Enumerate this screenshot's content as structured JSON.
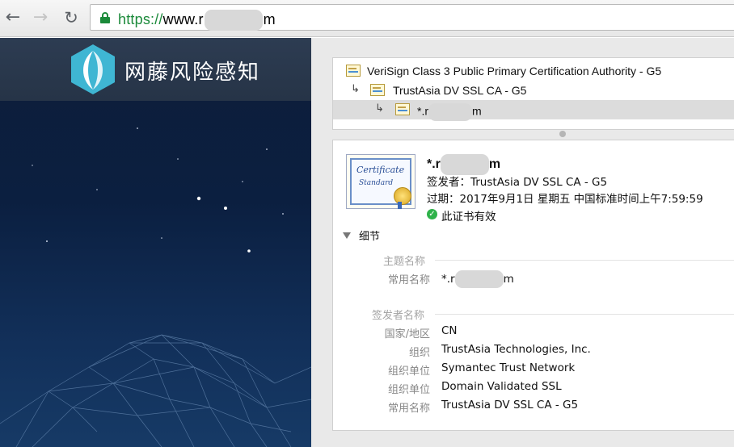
{
  "browser": {
    "url_scheme": "https://",
    "url_prefix": "www.r",
    "url_suffix": "m",
    "icons": {
      "back": "back-arrow-icon",
      "forward": "forward-arrow-icon",
      "reload": "reload-icon",
      "lock": "lock-icon"
    },
    "colors": {
      "secure_green": "#1b8a3a"
    }
  },
  "site": {
    "brand_name": "网藤风险感知",
    "colors": {
      "logo_teal": "#3fb6d3",
      "header_bg": "#2d3c52",
      "page_bg": "#0b1f40"
    }
  },
  "cert_chain": [
    {
      "label": "VeriSign Class 3 Public Primary Certification Authority - G5",
      "level": 0,
      "masked": false
    },
    {
      "label": "TrustAsia DV SSL CA - G5",
      "level": 1,
      "masked": false
    },
    {
      "label_prefix": "*.r",
      "label_suffix": "m",
      "level": 2,
      "masked": true,
      "selected": true
    }
  ],
  "cert": {
    "name_prefix": "*.r",
    "name_suffix": "m",
    "image_text_1": "Certificate",
    "image_text_2": "Standard",
    "issuer_line": "签发者：TrustAsia DV SSL CA - G5",
    "expiry_line": "过期：2017年9月1日 星期五 中国标准时间上午7:59:59",
    "valid_text": "此证书有效",
    "valid_color": "#2fb24a"
  },
  "details": {
    "toggle_label": "细节",
    "subject": {
      "heading": "主题名称",
      "common_name_key": "常用名称",
      "common_name_prefix": "*.r",
      "common_name_suffix": "m"
    },
    "issuer": {
      "heading": "签发者名称",
      "rows": [
        {
          "key": "国家/地区",
          "value": "CN"
        },
        {
          "key": "组织",
          "value": "TrustAsia Technologies, Inc."
        },
        {
          "key": "组织单位",
          "value": "Symantec Trust Network"
        },
        {
          "key": "组织单位",
          "value": "Domain Validated SSL"
        },
        {
          "key": "常用名称",
          "value": "TrustAsia DV SSL CA - G5"
        }
      ]
    }
  }
}
